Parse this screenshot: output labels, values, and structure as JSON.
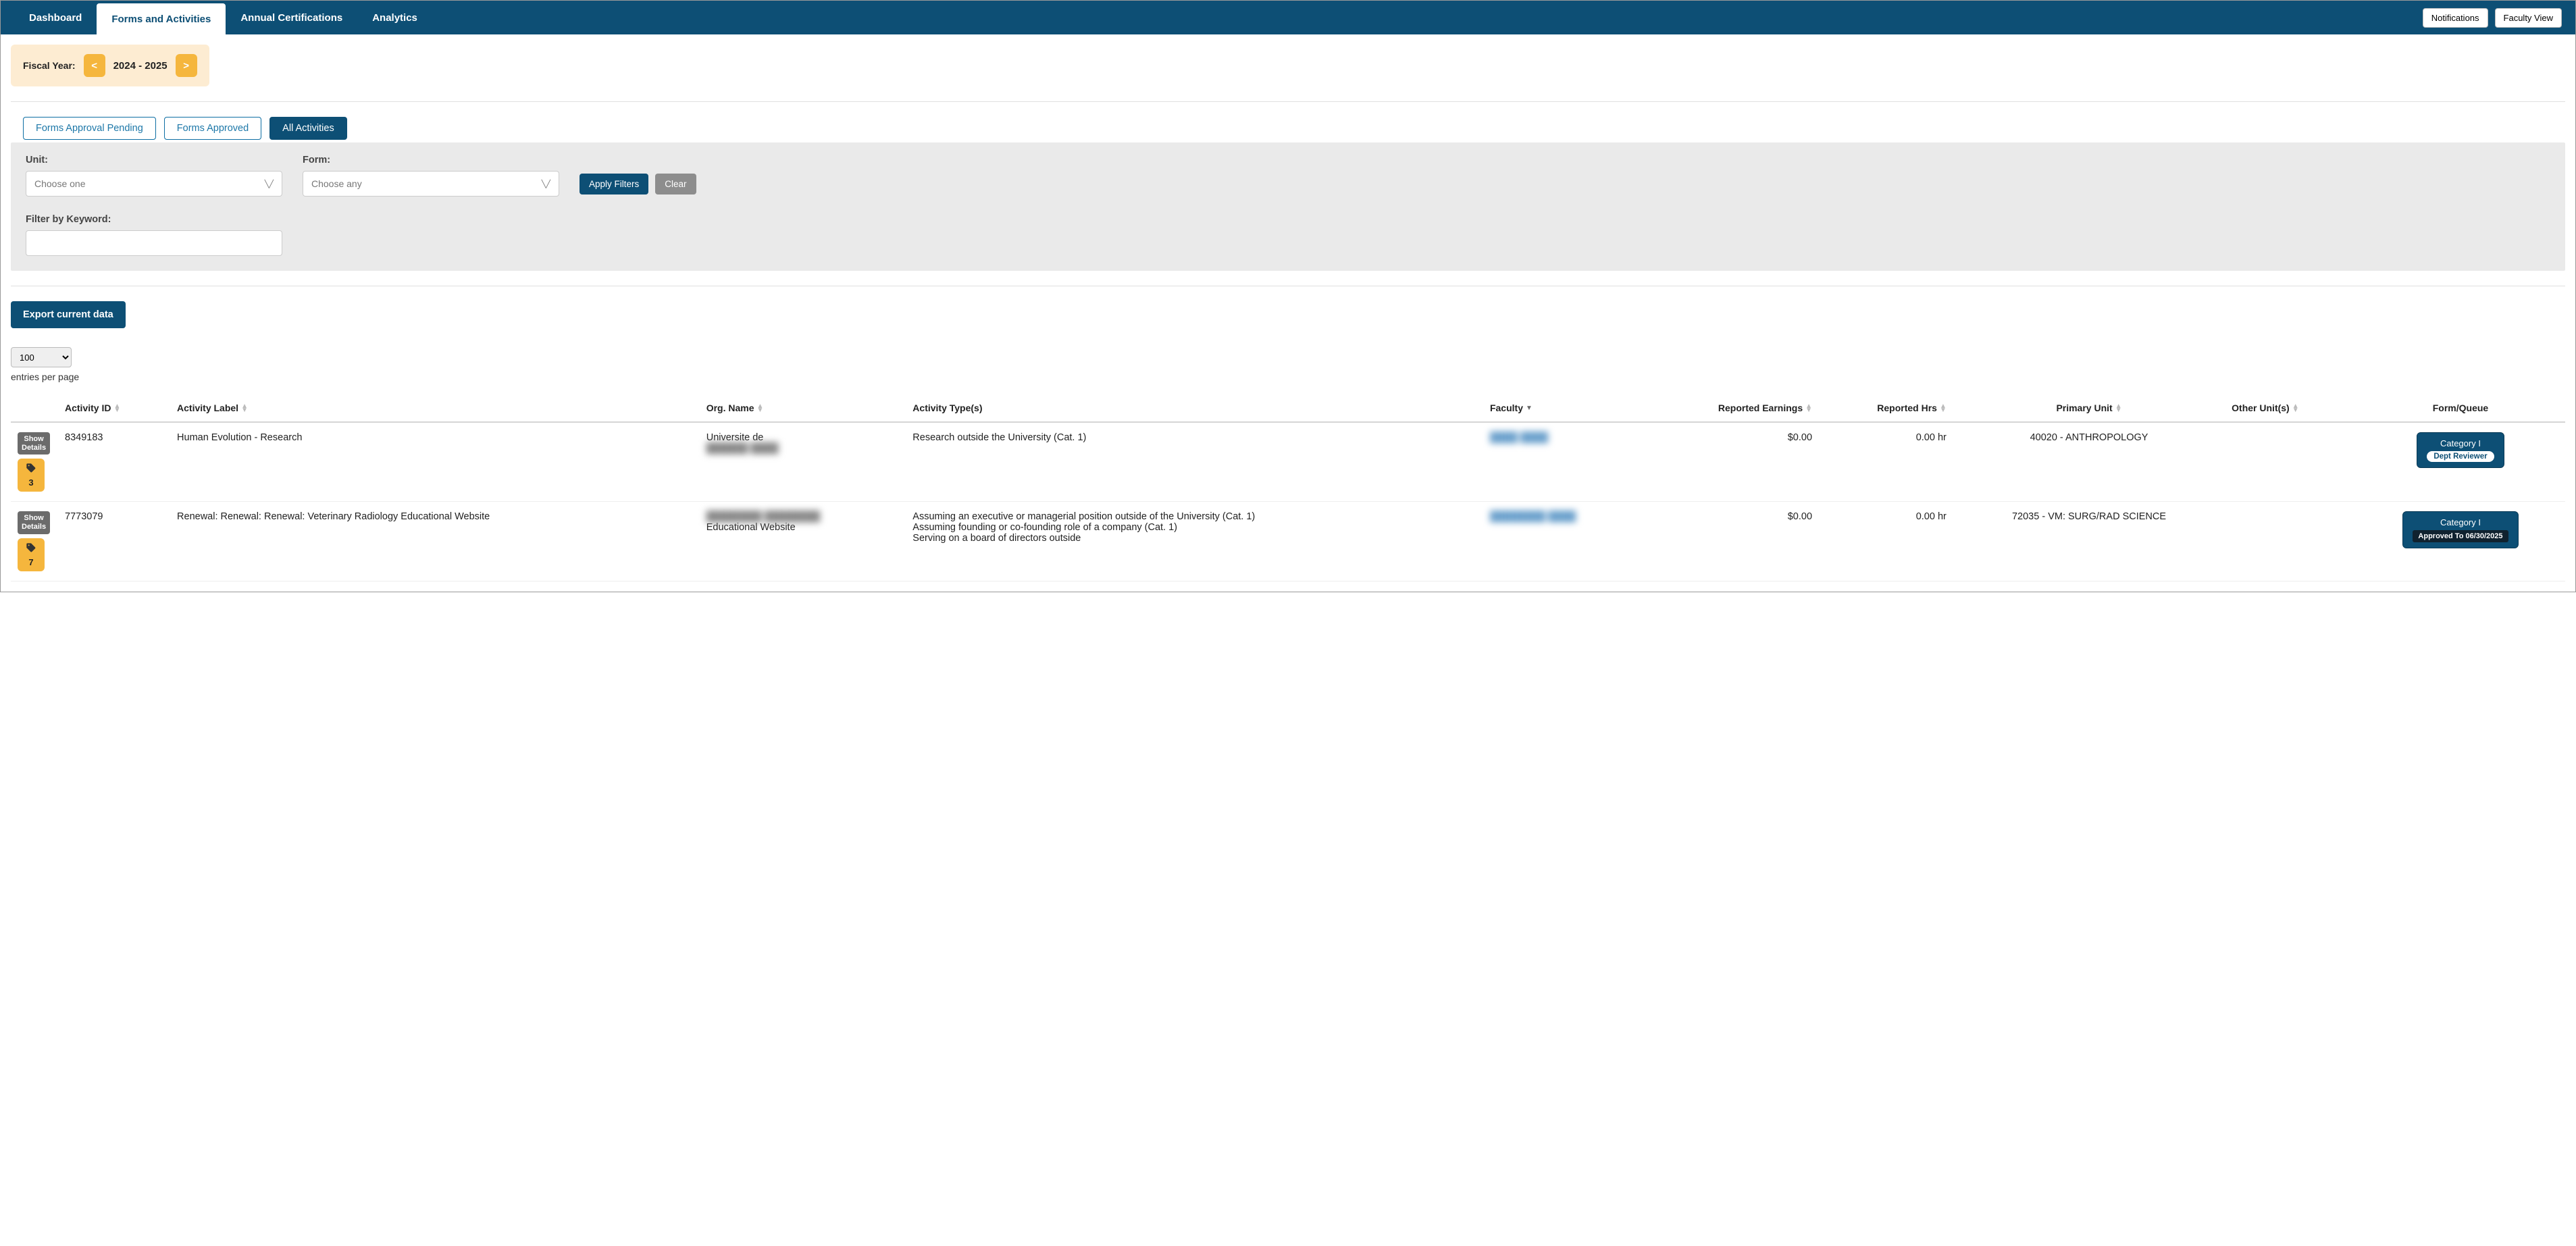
{
  "topbar": {
    "tabs": [
      "Dashboard",
      "Forms and Activities",
      "Annual Certifications",
      "Analytics"
    ],
    "active_index": 1,
    "notifications_label": "Notifications",
    "faculty_view_label": "Faculty View"
  },
  "fiscal": {
    "label": "Fiscal Year:",
    "prev": "<",
    "range": "2024 - 2025",
    "next": ">"
  },
  "subtabs": {
    "items": [
      "Forms Approval Pending",
      "Forms Approved",
      "All Activities"
    ],
    "active_index": 2
  },
  "filters": {
    "unit_label": "Unit:",
    "unit_placeholder": "Choose one",
    "form_label": "Form:",
    "form_placeholder": "Choose any",
    "keyword_label": "Filter by Keyword:",
    "keyword_value": "",
    "apply_label": "Apply Filters",
    "clear_label": "Clear"
  },
  "export_label": "Export current data",
  "pager": {
    "page_size": "100",
    "entries_label": "entries per page"
  },
  "columns": {
    "c0": "",
    "c1": "Activity ID",
    "c2": "Activity Label",
    "c3": "Org. Name",
    "c4": "Activity Type(s)",
    "c5": "Faculty",
    "c6": "Reported Earnings",
    "c7": "Reported Hrs",
    "c8": "Primary Unit",
    "c9": "Other Unit(s)",
    "c10": "Form/Queue"
  },
  "rows": [
    {
      "show_details": "Show\nDetails",
      "attach_count": "3",
      "activity_id": "8349183",
      "activity_label": "Human Evolution - Research",
      "org_name": "Universite de",
      "org_name_blur": "██████ ████",
      "activity_types": "Research outside the University (Cat. 1)",
      "faculty_blur": "████ ████",
      "earnings": "$0.00",
      "hours": "0.00 hr",
      "primary_unit": "40020 - ANTHROPOLOGY",
      "other_units": "",
      "queue_title": "Category I",
      "queue_sub": "Dept Reviewer",
      "queue_style": "white"
    },
    {
      "show_details": "Show\nDetails",
      "attach_count": "7",
      "activity_id": "7773079",
      "activity_label": "Renewal: Renewal: Renewal: Veterinary Radiology Educational Website",
      "org_name_blur": "████████ ████████",
      "org_name": "Educational Website",
      "activity_types": "Assuming an executive or managerial position outside of the University (Cat. 1)\nAssuming founding or co-founding role of a company (Cat. 1)\nServing on a board of directors outside",
      "faculty_blur": "████████ ████",
      "earnings": "$0.00",
      "hours": "0.00 hr",
      "primary_unit": "72035 - VM: SURG/RAD SCIENCE",
      "other_units": "",
      "queue_title": "Category I",
      "queue_sub": "Approved To 06/30/2025",
      "queue_style": "black"
    }
  ]
}
